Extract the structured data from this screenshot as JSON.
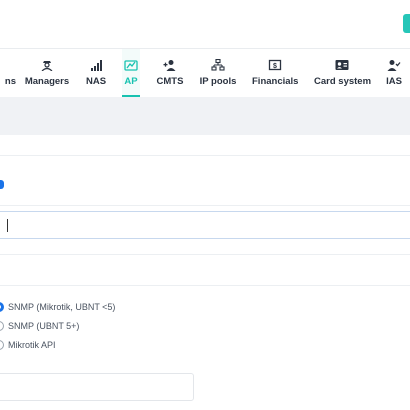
{
  "colors": {
    "accent": "#17c2b0",
    "primary": "#1a73e8"
  },
  "tabs": [
    {
      "label": "ns",
      "icon": "none",
      "active": false
    },
    {
      "label": "Managers",
      "icon": "manager-icon",
      "active": false
    },
    {
      "label": "NAS",
      "icon": "signal-bars-icon",
      "active": false
    },
    {
      "label": "AP",
      "icon": "access-point-icon",
      "active": true
    },
    {
      "label": "CMTS",
      "icon": "user-plus-icon",
      "active": false
    },
    {
      "label": "IP pools",
      "icon": "network-icon",
      "active": false
    },
    {
      "label": "Financials",
      "icon": "money-icon",
      "active": false
    },
    {
      "label": "Card system",
      "icon": "id-card-icon",
      "active": false
    },
    {
      "label": "IAS",
      "icon": "user-check-icon",
      "active": false
    }
  ],
  "form": {
    "radio_options": [
      {
        "label": "SNMP (Mikrotik, UBNT <5)",
        "checked": true
      },
      {
        "label": "SNMP (UBNT 5+)",
        "checked": false
      },
      {
        "label": "Mikrotik API",
        "checked": false
      }
    ]
  }
}
